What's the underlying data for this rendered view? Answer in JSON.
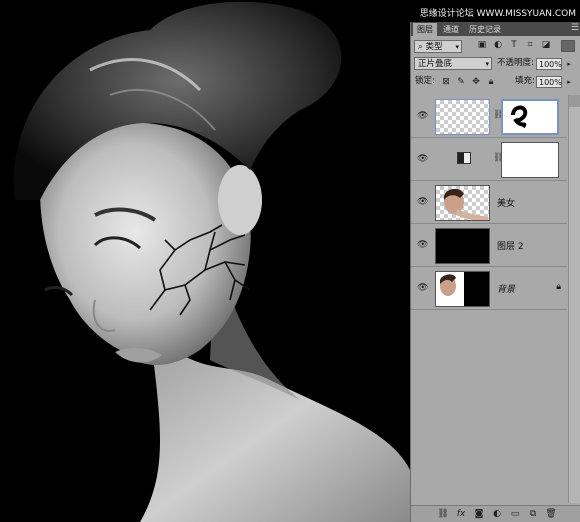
{
  "watermark": "思缘设计论坛 WWW.MISSYUAN.COM",
  "panel": {
    "tabs": [
      "图层",
      "通道",
      "历史记录"
    ],
    "filter": {
      "label": "类型"
    },
    "blend_mode": "正片叠底",
    "opacity_label": "不透明度:",
    "opacity_value": "100%",
    "lock_label": "锁定:",
    "fill_label": "填充:",
    "fill_value": "100%",
    "layers": [
      {
        "name": ""
      },
      {
        "name": ""
      },
      {
        "name": "美女"
      },
      {
        "name": "图层 2"
      },
      {
        "name": "背景"
      }
    ]
  },
  "icons": {
    "eye": "eye-icon",
    "chain": "link-icon",
    "lock": "lock-icon",
    "menu": "panel-menu-icon"
  },
  "colors": {
    "panel_bg": "#a9a9a9",
    "tab_bar": "#4a4a4a",
    "selection": "#7b93c2"
  }
}
